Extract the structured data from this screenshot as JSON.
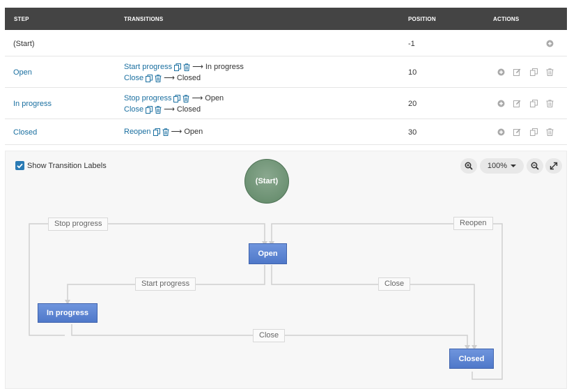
{
  "table": {
    "headers": {
      "step": "Step",
      "transitions": "Transitions",
      "position": "Position",
      "actions": "Actions"
    },
    "rows": [
      {
        "step": "(Start)",
        "position": "-1",
        "transitions": []
      },
      {
        "step": "Open",
        "position": "10",
        "transitions": [
          {
            "name": "Start progress",
            "arrow": "⟶",
            "to": "In progress"
          },
          {
            "name": "Close",
            "arrow": "⟶",
            "to": "Closed"
          }
        ]
      },
      {
        "step": "In progress",
        "position": "20",
        "transitions": [
          {
            "name": "Stop progress",
            "arrow": "⟶",
            "to": "Open"
          },
          {
            "name": "Close",
            "arrow": "⟶",
            "to": "Closed"
          }
        ]
      },
      {
        "step": "Closed",
        "position": "30",
        "transitions": [
          {
            "name": "Reopen",
            "arrow": "⟶",
            "to": "Open"
          }
        ]
      }
    ]
  },
  "diagram": {
    "show_labels_text": "Show Transition Labels",
    "show_labels_checked": true,
    "zoom_level": "100%",
    "nodes": {
      "start": "(Start)",
      "open": "Open",
      "in_progress": "In progress",
      "closed": "Closed"
    },
    "labels": {
      "stop_progress": "Stop progress",
      "reopen": "Reopen",
      "start_progress": "Start progress",
      "close_open": "Close",
      "close_inprogress": "Close"
    }
  },
  "icons": {
    "add": "plus-circle-icon",
    "edit": "pencil-square-icon",
    "copy": "copy-icon",
    "delete": "trash-icon",
    "zoom_in": "zoom-in-icon",
    "zoom_out": "zoom-out-icon",
    "fullscreen": "expand-icon",
    "checkbox": "check-icon"
  },
  "colors": {
    "header_bg": "#444444",
    "link": "#1a6fa0",
    "node": "#5a82d0",
    "start_node": "#6f9477",
    "checkbox": "#2a7bb5"
  }
}
